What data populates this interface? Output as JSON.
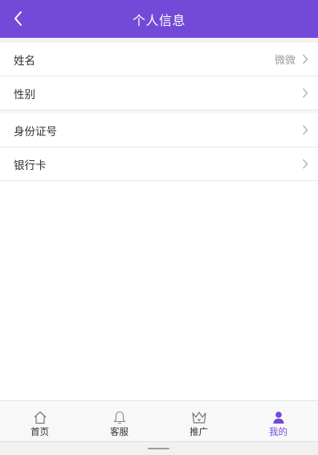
{
  "header": {
    "title": "个人信息",
    "background": "#7349d8",
    "back_icon": "chevron-left-icon"
  },
  "info_rows": [
    {
      "label": "姓名",
      "value": "微微"
    },
    {
      "label": "性别",
      "value": ""
    }
  ],
  "id_rows": [
    {
      "label": "身份证号",
      "value": ""
    },
    {
      "label": "银行卡",
      "value": ""
    }
  ],
  "tabbar": {
    "active_color": "#7349d8",
    "items": [
      {
        "label": "首页",
        "icon": "home-icon"
      },
      {
        "label": "客服",
        "icon": "bell-icon"
      },
      {
        "label": "推广",
        "icon": "crown-icon"
      },
      {
        "label": "我的",
        "icon": "person-icon"
      }
    ]
  }
}
